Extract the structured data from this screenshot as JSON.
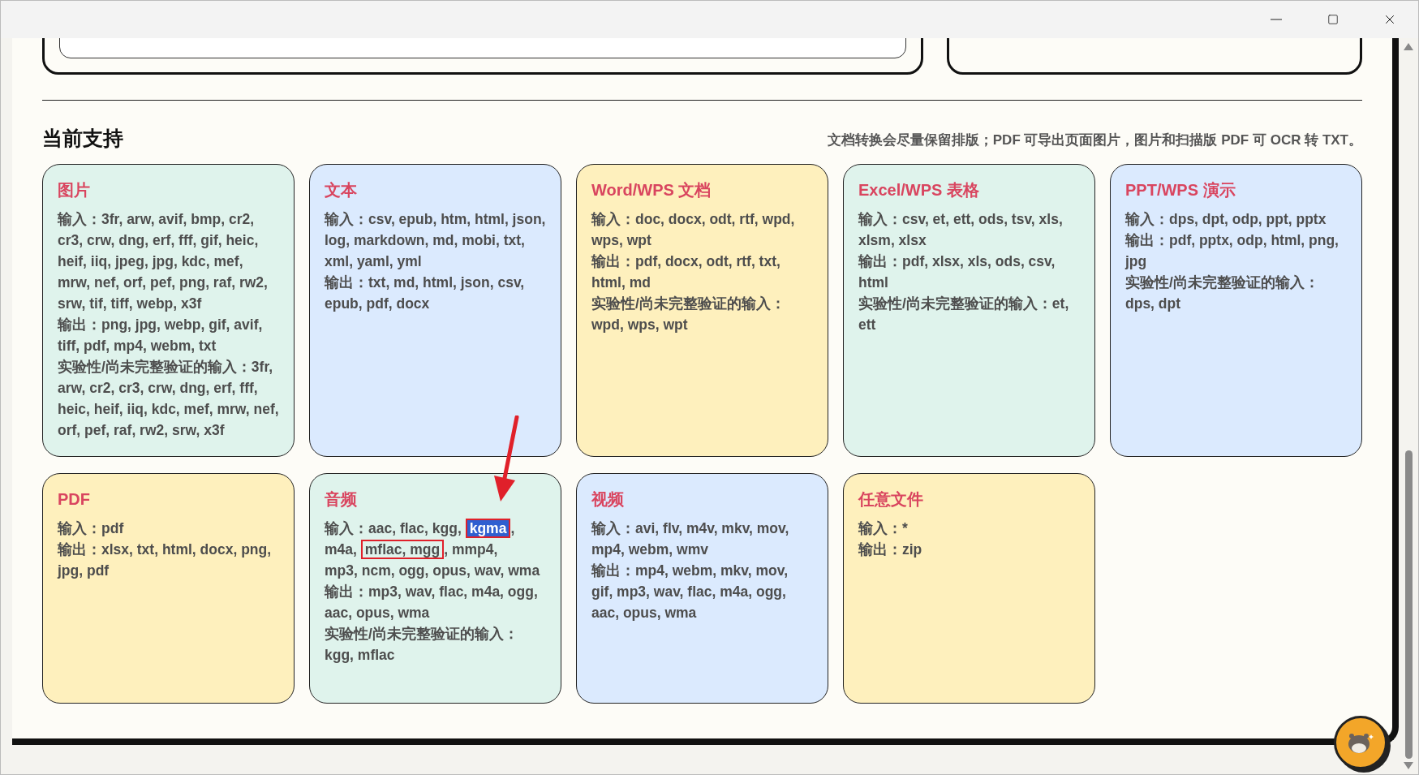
{
  "section": {
    "title": "当前支持",
    "note": "文档转换会尽量保留排版；PDF 可导出页面图片，图片和扫描版 PDF 可 OCR 转 TXT。"
  },
  "cards": [
    {
      "title": "图片",
      "color": "#dff3ec",
      "lines": [
        {
          "kind": "plain",
          "text": "输入：3fr, arw, avif, bmp, cr2, cr3, crw, dng, erf, fff, gif, heic, heif, iiq, jpeg, jpg, kdc, mef, mrw, nef, orf, pef, png, raf, rw2, srw, tif, tiff, webp, x3f"
        },
        {
          "kind": "plain",
          "text": "输出：png, jpg, webp, gif, avif, tiff, pdf, mp4, webm, txt"
        },
        {
          "kind": "plain",
          "text": "实验性/尚未完整验证的输入：3fr, arw, cr2, cr3, crw, dng, erf, fff, heic, heif, iiq, kdc, mef, mrw, nef, orf, pef, raf, rw2, srw, x3f"
        }
      ]
    },
    {
      "title": "文本",
      "color": "#dbeafe",
      "lines": [
        {
          "kind": "plain",
          "text": "输入：csv, epub, htm, html, json, log, markdown, md, mobi, txt, xml, yaml, yml"
        },
        {
          "kind": "plain",
          "text": "输出：txt, md, html, json, csv, epub, pdf, docx"
        }
      ]
    },
    {
      "title": "Word/WPS 文档",
      "color": "#fef0bd",
      "lines": [
        {
          "kind": "plain",
          "text": "输入：doc, docx, odt, rtf, wpd, wps, wpt"
        },
        {
          "kind": "plain",
          "text": "输出：pdf, docx, odt, rtf, txt, html, md"
        },
        {
          "kind": "plain",
          "text": "实验性/尚未完整验证的输入：wpd, wps, wpt"
        }
      ]
    },
    {
      "title": "Excel/WPS 表格",
      "color": "#dff3ec",
      "lines": [
        {
          "kind": "plain",
          "text": "输入：csv, et, ett, ods, tsv, xls, xlsm, xlsx"
        },
        {
          "kind": "plain",
          "text": "输出：pdf, xlsx, xls, ods, csv, html"
        },
        {
          "kind": "plain",
          "text": "实验性/尚未完整验证的输入：et, ett"
        }
      ]
    },
    {
      "title": "PPT/WPS 演示",
      "color": "#dbeafe",
      "lines": [
        {
          "kind": "plain",
          "text": "输入：dps, dpt, odp, ppt, pptx"
        },
        {
          "kind": "plain",
          "text": "输出：pdf, pptx, odp, html, png, jpg"
        },
        {
          "kind": "plain",
          "text": "实验性/尚未完整验证的输入：dps, dpt"
        }
      ]
    },
    {
      "title": "PDF",
      "color": "#fef0bd",
      "lines": [
        {
          "kind": "plain",
          "text": "输入：pdf"
        },
        {
          "kind": "plain",
          "text": "输出：xlsx, txt, html, docx, png, jpg, pdf"
        }
      ]
    },
    {
      "title": "音频",
      "color": "#dff3ec",
      "lines": [
        {
          "kind": "marked",
          "segments": [
            {
              "text": "输入：aac, flac, kgg, ",
              "highlighted": false,
              "boxed": false
            },
            {
              "text": "kgma",
              "highlighted": true,
              "boxed": true
            },
            {
              "text": ", ",
              "highlighted": false,
              "boxed": false
            },
            {
              "text": "m4a, ",
              "highlighted": false,
              "boxed": false
            },
            {
              "text": "mflac, mgg",
              "highlighted": false,
              "boxed": true
            },
            {
              "text": ", mmp4, ",
              "highlighted": false,
              "boxed": false
            },
            {
              "text": "mp3, ncm, ogg, opus, wav, ",
              "highlighted": false,
              "boxed": false
            },
            {
              "text": "wma",
              "highlighted": false,
              "boxed": false
            }
          ]
        },
        {
          "kind": "plain",
          "text": "输出：mp3, wav, flac, m4a, ogg, aac, opus, wma"
        },
        {
          "kind": "plain",
          "text": "实验性/尚未完整验证的输入：kgg, mflac"
        }
      ],
      "arrow": true
    },
    {
      "title": "视频",
      "color": "#dbeafe",
      "lines": [
        {
          "kind": "plain",
          "text": "输入：avi, flv, m4v, mkv, mov, mp4, webm, wmv"
        },
        {
          "kind": "plain",
          "text": "输出：mp4, webm, mkv, mov, gif, mp3, wav, flac, m4a, ogg, aac, opus, wma"
        }
      ]
    },
    {
      "title": "任意文件",
      "color": "#fef0bd",
      "lines": [
        {
          "kind": "plain",
          "text": "输入：*"
        },
        {
          "kind": "plain",
          "text": "输出：zip"
        }
      ]
    }
  ]
}
